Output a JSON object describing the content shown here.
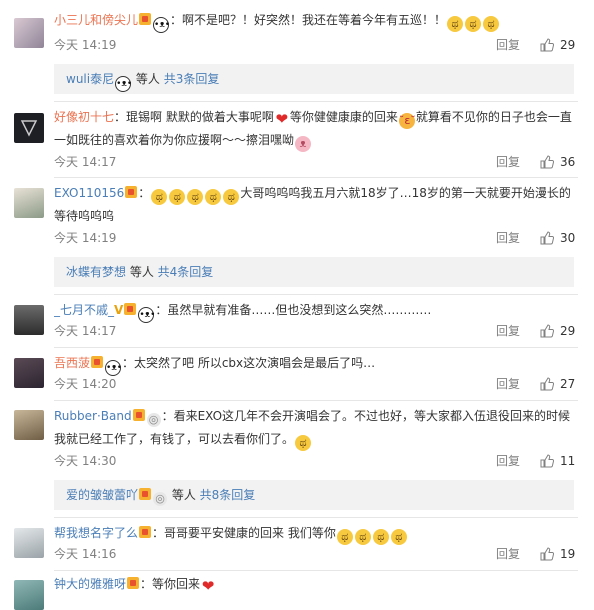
{
  "comments": [
    {
      "username": "小三儿和傍尖儿",
      "text": "：啊不是吧？！好突然！我还在等着今年有五巡！！",
      "time": "今天 14:19",
      "reply": "回复",
      "likes": "29"
    },
    {
      "username": "好像初十七",
      "text_a": "：琨锡啊 默默的做着大事呢啊",
      "text_b": "等你健健康康的回来",
      "text_c": "就算看不见你的日子也会一直一如既往的喜欢着你为你应援啊～～擦泪嘿呦",
      "time": "今天 14:17",
      "reply": "回复",
      "likes": "36"
    },
    {
      "username": "EXO110156",
      "text_a": "：",
      "text_b": "大哥呜呜呜我五月六就18岁了…18岁的第一天就要开始漫长的等待呜呜呜",
      "time": "今天 14:19",
      "reply": "回复",
      "likes": "30"
    },
    {
      "username": "_七月不戚_",
      "text": "：虽然早就有准备……但也没想到这么突然…………",
      "time": "今天 14:17",
      "reply": "回复",
      "likes": "29"
    },
    {
      "username": "吾西菠",
      "text": "：太突然了吧 所以cbx这次演唱会是最后了吗…",
      "time": "今天 14:20",
      "reply": "回复",
      "likes": "27"
    },
    {
      "username": "Rubber·Band",
      "text_a": "：看来EXO这几年不会开演唱会了。不过也好，等大家都入伍退役回来的时候我就已经工作了，有钱了，可以去看你们了。",
      "time": "今天 14:30",
      "reply": "回复",
      "likes": "11"
    },
    {
      "username": "帮我想名字了么",
      "text_a": "：哥哥要平安健康的回来 我们等你",
      "time": "今天 14:16",
      "reply": "回复",
      "likes": "19"
    },
    {
      "username": "钟大的雅雅呀",
      "text_a": "：等你回来"
    }
  ],
  "subreplies": [
    {
      "user": "wuli泰尼",
      "mid": " 等人 ",
      "link": "共3条回复"
    },
    {
      "user": "冰蝶有梦想",
      "mid": " 等人 ",
      "link": "共4条回复"
    },
    {
      "user": "爱的皱皱蕾吖",
      "mid": " 等人 ",
      "link": "共8条回复"
    }
  ],
  "icons": {
    "like": "thumbs-up-icon",
    "badge": "vip-badge-icon",
    "cry": "crying-emoji-icon",
    "panda": "panda-emoji-icon",
    "heart": "heart-emoji-icon"
  },
  "colors": {
    "username": "#eb7350",
    "link": "#4a7eb7",
    "meta": "#808080",
    "subreply_bg": "#f2f2f2"
  }
}
